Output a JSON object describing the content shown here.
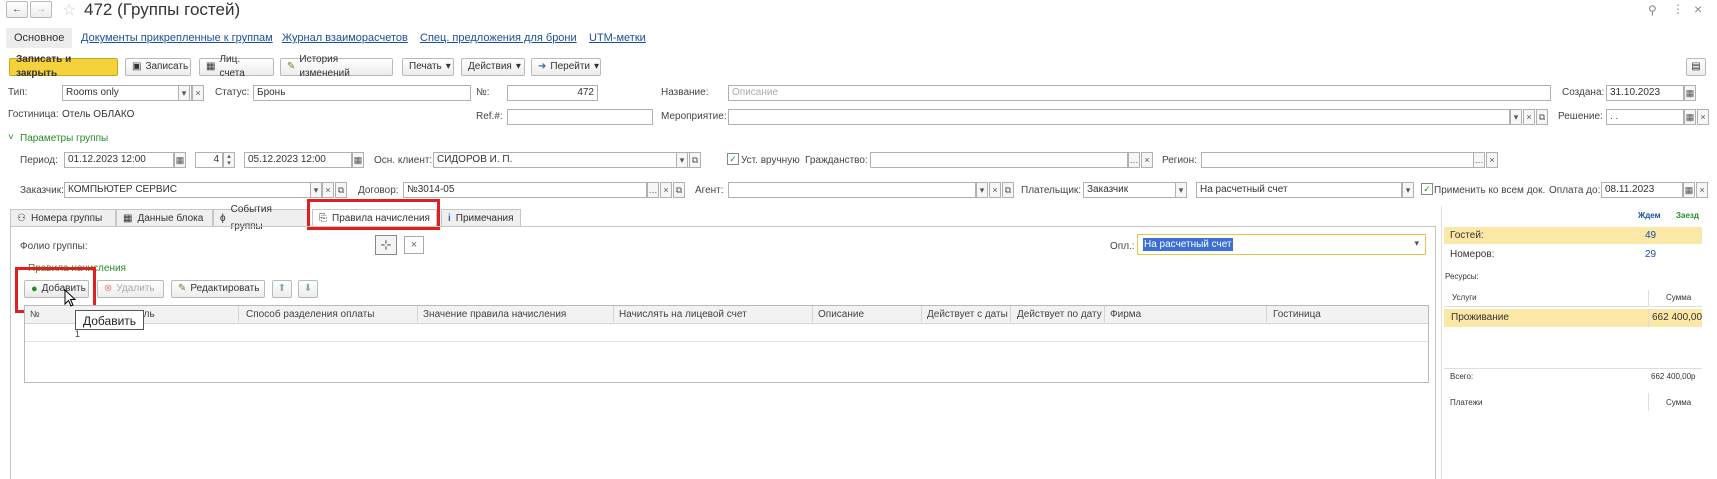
{
  "window": {
    "title": "472 (Группы гостей)"
  },
  "nav_links": [
    "Основное",
    "Документы прикрепленные к группам",
    "Журнал взаиморасчетов",
    "Спец. предложения для брони",
    "UTM-метки"
  ],
  "toolbar": {
    "save_close": "Записать и закрыть",
    "save": "Записать",
    "account": "Лиц. счета",
    "history": "История изменений",
    "print": "Печать",
    "actions": "Действия",
    "goto": "Перейти"
  },
  "form": {
    "type_label": "Тип:",
    "type_value": "Rooms only",
    "status_label": "Статус:",
    "status_value": "Бронь",
    "number_label": "№:",
    "number_value": "472",
    "name_label": "Название:",
    "name_placeholder": "Описание",
    "created_label": "Создана:",
    "created_value": "31.10.2023",
    "hotel_label": "Гостиница:",
    "hotel_value": "Отель ОБЛАКО",
    "ref_label": "Ref.#:",
    "event_label": "Мероприятие:",
    "decision_label": "Решение:",
    "decision_value": ". .",
    "params_header": "Параметры группы",
    "period_label": "Период:",
    "period_from": "01.12.2023 12:00",
    "period_days": "4",
    "period_to": "05.12.2023 12:00",
    "client_label": "Осн. клиент:",
    "client_value": "СИДОРОВ И. П.",
    "manual_label": "Уст. вручную",
    "citizenship_label": "Гражданство:",
    "region_label": "Регион:",
    "customer_label": "Заказчик:",
    "customer_value": "КОМПЬЮТЕР СЕРВИС",
    "contract_label": "Договор:",
    "contract_value": "№3014-05",
    "agent_label": "Агент:",
    "payer_label": "Плательщик:",
    "payer_value": "Заказчик",
    "payment_method": "На расчетный счет",
    "apply_all_label": "Применить ко всем док.",
    "pay_until_label": "Оплата до:",
    "pay_until_value": "08.11.2023"
  },
  "tabs": [
    "Номера группы",
    "Данные блока",
    "События группы",
    "Правила начисления",
    "Примечания"
  ],
  "rules_panel": {
    "folio_label": "Фолио группы:",
    "opl_label": "Опл.:",
    "opl_value": "На расчетный счет",
    "section_title": "Правила начисления",
    "add_btn": "Добавить",
    "delete_btn": "Удалить",
    "edit_btn": "Редактировать",
    "tooltip": "Добавить",
    "columns": [
      "№",
      "Получатель",
      "Способ разделения оплаты",
      "Значение правила начисления",
      "Начислять на лицевой счет",
      "Описание",
      "Действует с даты",
      "Действует по дату",
      "Фирма",
      "Гостиница"
    ],
    "row_number": "1"
  },
  "summary": {
    "col_wait": "Ждем",
    "col_arrived": "Заезд",
    "guests_label": "Гостей:",
    "guests_value": "49",
    "rooms_label": "Номеров:",
    "rooms_value": "29",
    "resources_label": "Ресурсы:",
    "services_header": "Услуги",
    "sum_header": "Сумма",
    "service_name": "Проживание",
    "service_sum": "662 400,00",
    "total_label": "Всего:",
    "total_value": "662 400,00р",
    "payments_header": "Платежи",
    "payments_sum_header": "Сумма"
  },
  "colors": {
    "accent_yellow": "#f5d23c",
    "highlight_row": "#fbe7a6",
    "red_frame": "#e02020",
    "link": "#1a4fa0",
    "green": "#2a8a2a"
  }
}
